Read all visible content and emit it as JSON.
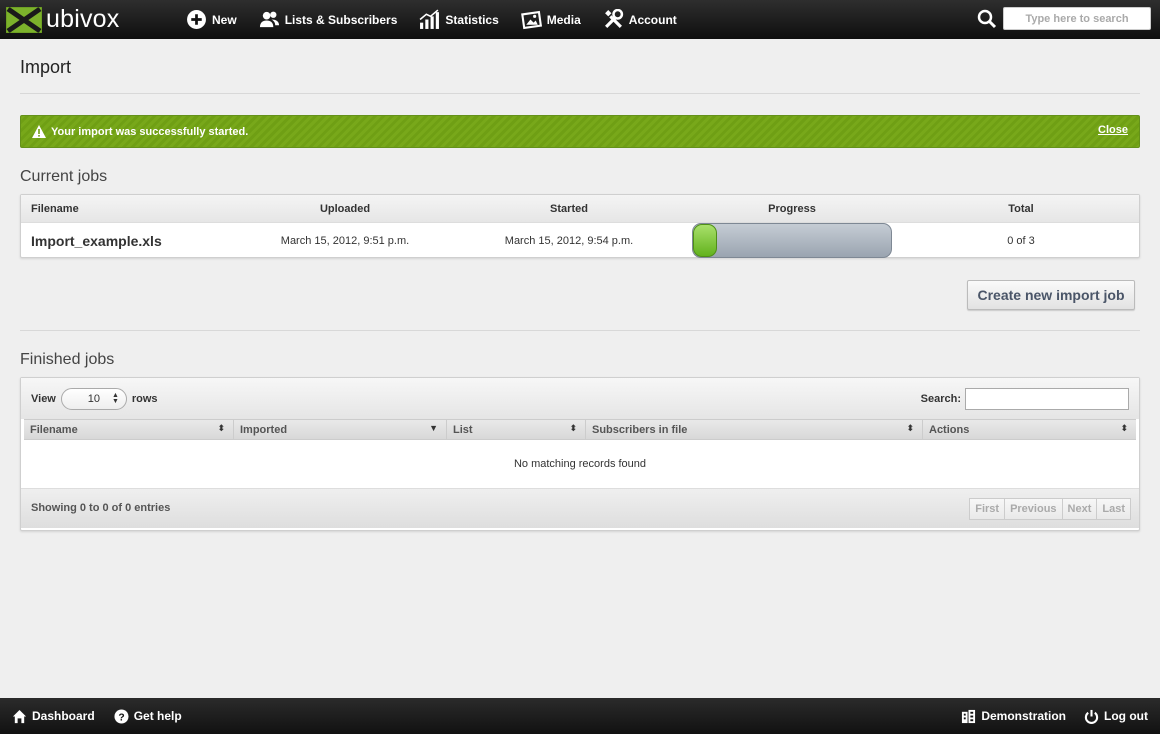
{
  "brand": {
    "name": "ubivox"
  },
  "nav": [
    {
      "label": "New",
      "icon": "plus-circle-icon"
    },
    {
      "label": "Lists & Subscribers",
      "icon": "users-icon"
    },
    {
      "label": "Statistics",
      "icon": "bar-chart-icon"
    },
    {
      "label": "Media",
      "icon": "image-icon"
    },
    {
      "label": "Account",
      "icon": "tools-icon"
    }
  ],
  "top_search": {
    "placeholder": "Type here to search"
  },
  "page": {
    "title": "Import"
  },
  "alert": {
    "message": "Your import was successfully started.",
    "close_label": "Close",
    "color": "#78a81a"
  },
  "current_jobs": {
    "title": "Current jobs",
    "columns": [
      "Filename",
      "Uploaded",
      "Started",
      "Progress",
      "Total"
    ],
    "rows": [
      {
        "filename": "Import_example.xls",
        "uploaded": "March 15, 2012, 9:51 p.m.",
        "started": "March 15, 2012, 9:54 p.m.",
        "progress": 0.0,
        "total": "0 of 3"
      }
    ]
  },
  "create_button": {
    "label": "Create new import job"
  },
  "finished_jobs": {
    "title": "Finished jobs",
    "view_label": "View",
    "rows_value": "10",
    "rows_label": "rows",
    "search_label": "Search:",
    "columns": [
      "Filename",
      "Imported",
      "List",
      "Subscribers in file",
      "Actions"
    ],
    "empty_text": "No matching records found",
    "info": "Showing 0 to 0 of 0 entries",
    "pager": [
      "First",
      "Previous",
      "Next",
      "Last"
    ]
  },
  "footer": {
    "left": [
      {
        "label": "Dashboard",
        "icon": "home-icon"
      },
      {
        "label": "Get help",
        "icon": "help-icon"
      }
    ],
    "right": [
      {
        "label": "Demonstration",
        "icon": "building-icon"
      },
      {
        "label": "Log out",
        "icon": "power-icon"
      }
    ]
  }
}
